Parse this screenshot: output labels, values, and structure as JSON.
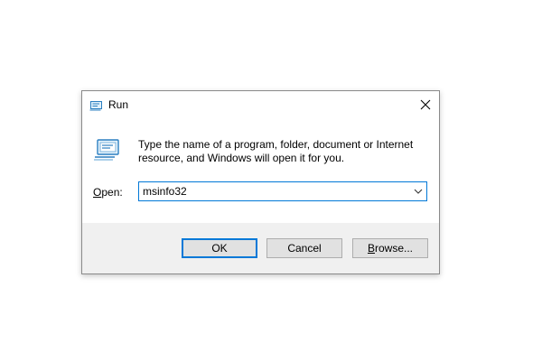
{
  "window": {
    "title": "Run",
    "close_icon": "close-icon",
    "title_icon": "run-icon"
  },
  "body": {
    "description": "Type the name of a program, folder, document or Internet resource, and Windows will open it for you.",
    "open_label_mnemonic": "O",
    "open_label_rest": "pen:",
    "open_value": "msinfo32",
    "dropdown_icon": "chevron-down-icon"
  },
  "buttons": {
    "ok": "OK",
    "cancel": "Cancel",
    "browse_mnemonic": "B",
    "browse_rest": "rowse..."
  },
  "colors": {
    "accent": "#0078d7",
    "footer_bg": "#f0f0f0",
    "button_bg": "#e1e1e1"
  }
}
